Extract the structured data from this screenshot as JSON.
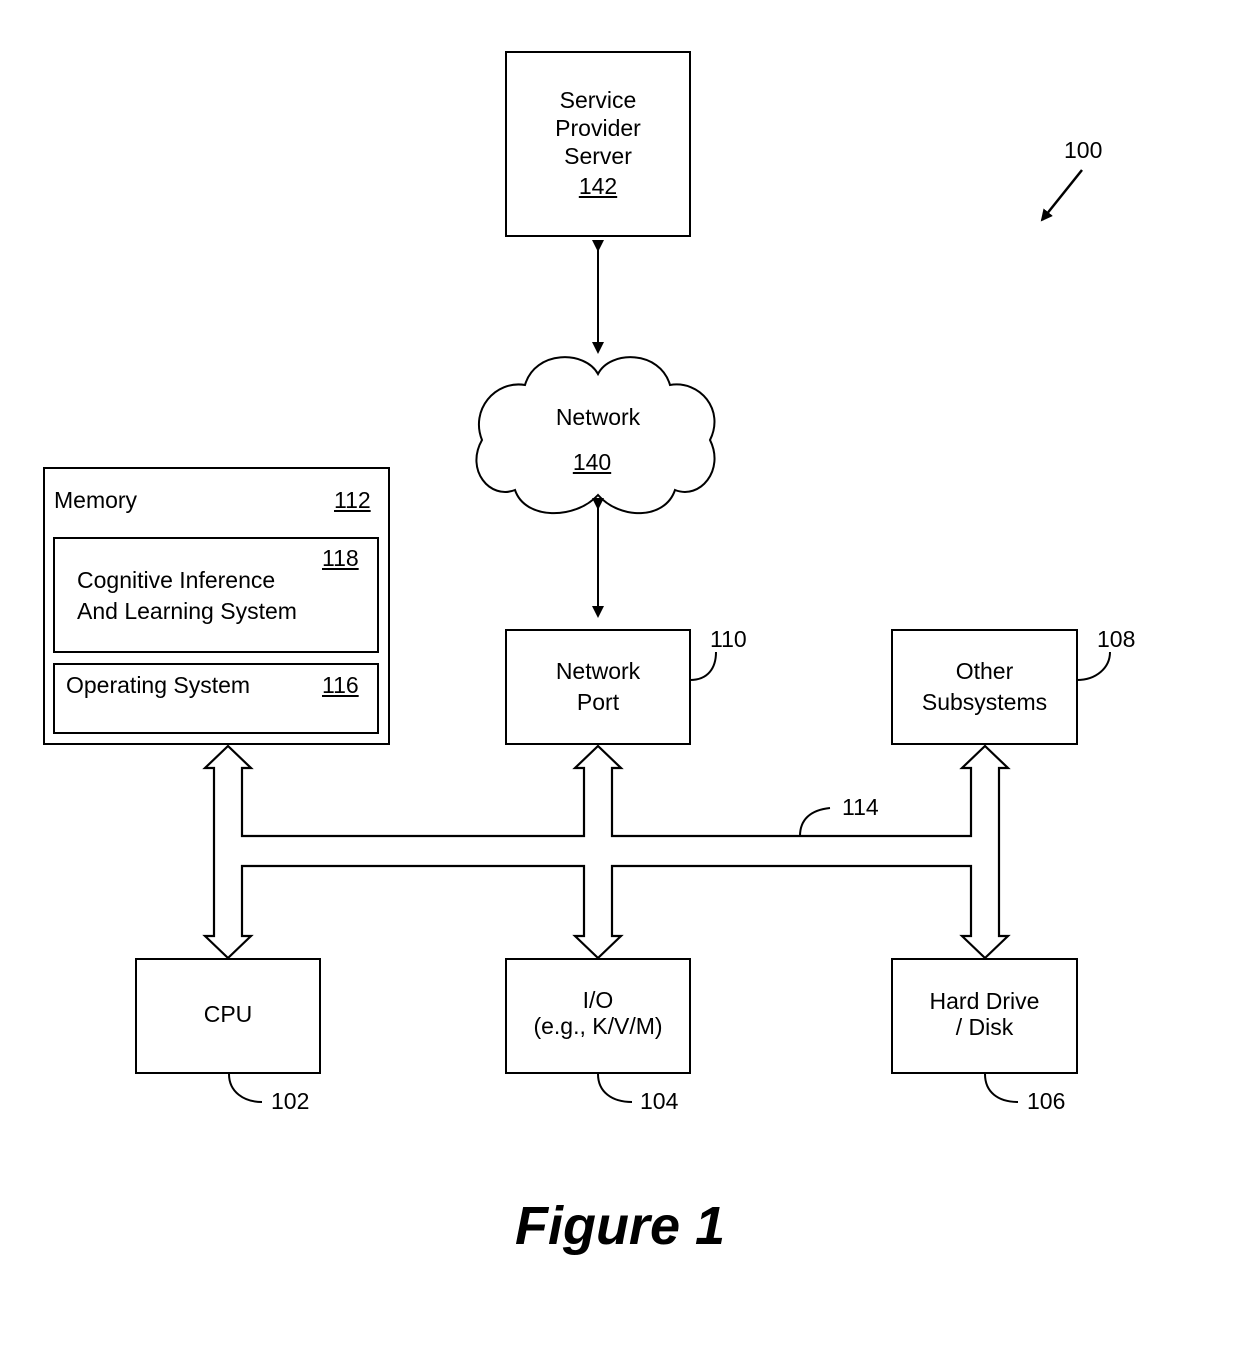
{
  "figure_label": "Figure 1",
  "system_ref": "100",
  "nodes": {
    "server": {
      "lines": [
        "Service",
        "Provider",
        "Server"
      ],
      "ref": "142"
    },
    "network": {
      "label": "Network",
      "ref": "140"
    },
    "memory": {
      "label": "Memory",
      "ref": "112"
    },
    "cils": {
      "lines": [
        "Cognitive Inference",
        "And Learning System"
      ],
      "ref": "118"
    },
    "os": {
      "label": "Operating System",
      "ref": "116"
    },
    "network_port": {
      "lines": [
        "Network",
        "Port"
      ],
      "ref": "110"
    },
    "other_subsystems": {
      "lines": [
        "Other",
        "Subsystems"
      ],
      "ref": "108"
    },
    "cpu": {
      "label": "CPU",
      "ref": "102"
    },
    "io": {
      "lines": [
        "I/O",
        "(e.g., K/V/M)"
      ],
      "ref": "104"
    },
    "hard_drive": {
      "lines": [
        "Hard Drive",
        "/ Disk"
      ],
      "ref": "106"
    },
    "bus": {
      "ref": "114"
    }
  },
  "edges": [
    {
      "from": "server",
      "to": "network",
      "type": "bidirectional"
    },
    {
      "from": "network",
      "to": "network_port",
      "type": "bidirectional"
    },
    {
      "from": "memory",
      "to": "bus",
      "type": "bidirectional"
    },
    {
      "from": "network_port",
      "to": "bus",
      "type": "bidirectional"
    },
    {
      "from": "other_subsystems",
      "to": "bus",
      "type": "bidirectional"
    },
    {
      "from": "bus",
      "to": "cpu",
      "type": "directed"
    },
    {
      "from": "bus",
      "to": "io",
      "type": "directed"
    },
    {
      "from": "bus",
      "to": "hard_drive",
      "type": "bidirectional"
    }
  ]
}
